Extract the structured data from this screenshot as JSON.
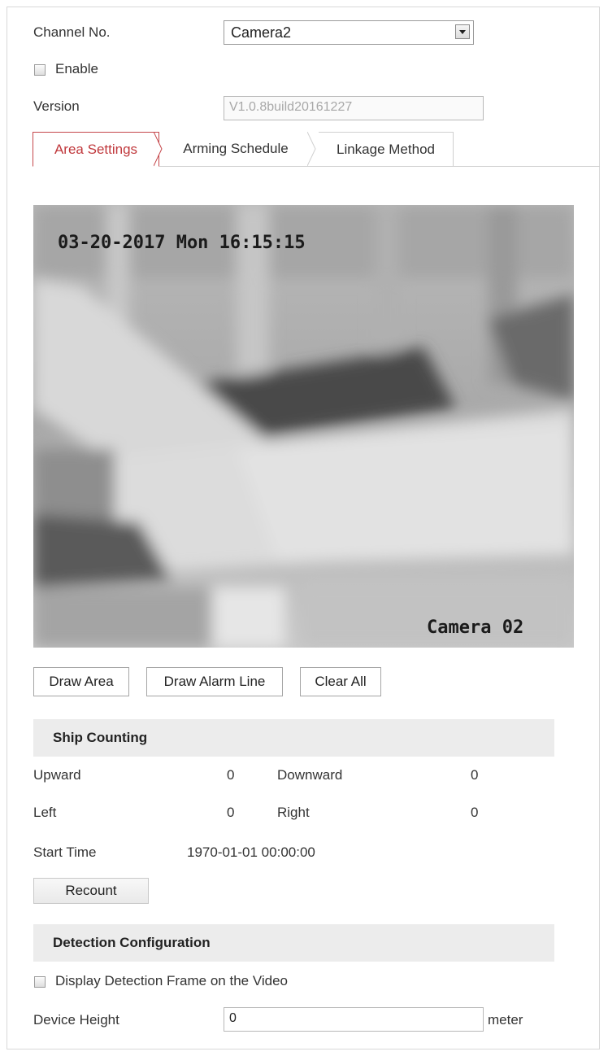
{
  "form": {
    "channel_label": "Channel No.",
    "channel_value": "Camera2",
    "enable_label": "Enable",
    "version_label": "Version",
    "version_value": "V1.0.8build20161227"
  },
  "tabs": [
    {
      "label": "Area Settings",
      "active": true
    },
    {
      "label": "Arming Schedule",
      "active": false
    },
    {
      "label": "Linkage Method",
      "active": false
    }
  ],
  "video": {
    "timestamp": "03-20-2017 Mon 16:15:15",
    "camera_label": "Camera 02"
  },
  "buttons": {
    "draw_area": "Draw Area",
    "draw_alarm_line": "Draw Alarm Line",
    "clear_all": "Clear All"
  },
  "ship_counting": {
    "title": "Ship Counting",
    "upward_label": "Upward",
    "upward_value": "0",
    "downward_label": "Downward",
    "downward_value": "0",
    "left_label": "Left",
    "left_value": "0",
    "right_label": "Right",
    "right_value": "0",
    "start_time_label": "Start Time",
    "start_time_value": "1970-01-01 00:00:00",
    "recount_label": "Recount"
  },
  "detection": {
    "title": "Detection Configuration",
    "display_frame_label": "Display Detection Frame on the Video",
    "device_height_label": "Device Height",
    "device_height_value": "0",
    "unit": "meter"
  },
  "colors": {
    "active_tab": "#c0383c",
    "section_bg": "#ececec"
  }
}
